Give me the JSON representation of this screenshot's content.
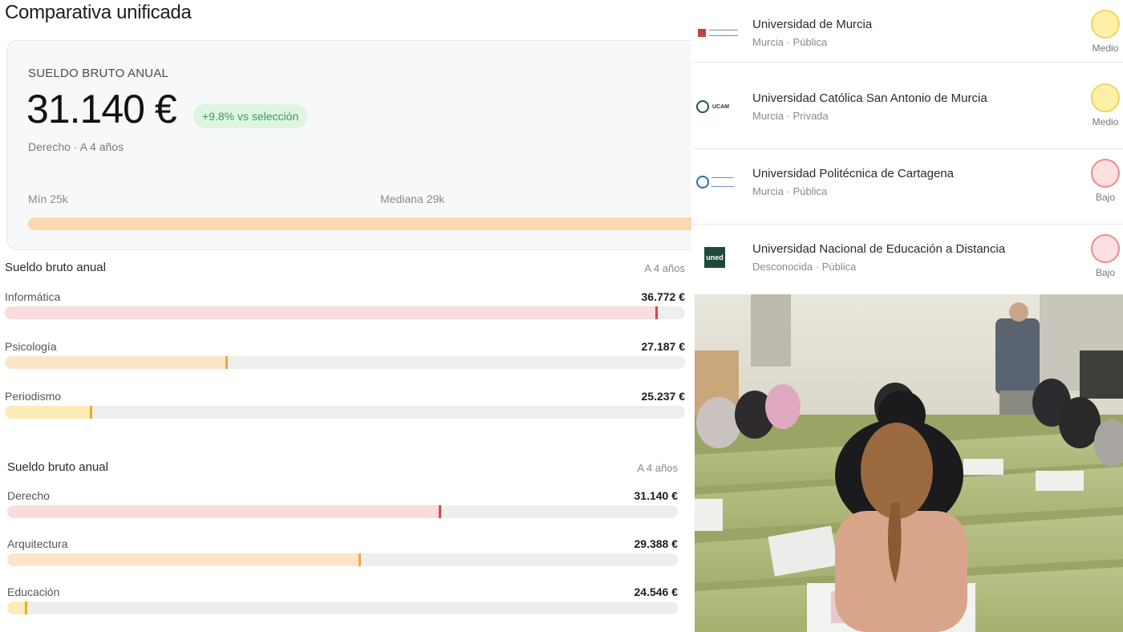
{
  "left": {
    "title": "Comparativa unificada",
    "card": {
      "label": "SUELDO BRUTO ANUAL",
      "value": "31.140 €",
      "badge": "+9.8% vs selección",
      "subtitle": "Derecho · A 4 años",
      "min_label": "Mín 25k",
      "median_label": "Mediana 29k"
    },
    "section1": {
      "heading": "Sueldo bruto anual",
      "period": "A 4 años",
      "rows": [
        {
          "label": "Informática",
          "value": "36.772 €",
          "fraction": 0.96,
          "fill_color": "#fadcdc",
          "mark_color": "#d9434b"
        },
        {
          "label": "Psicología",
          "value": "27.187 €",
          "fraction": 0.328,
          "fill_color": "#fde6c8",
          "mark_color": "#f0a53c"
        },
        {
          "label": "Periodismo",
          "value": "25.237 €",
          "fraction": 0.128,
          "fill_color": "#fdebb8",
          "mark_color": "#e0b020"
        }
      ]
    },
    "section2": {
      "heading": "Sueldo bruto anual",
      "period": "A 4 años",
      "rows": [
        {
          "label": "Derecho",
          "value": "31.140 €",
          "fraction": 0.647,
          "fill_color": "#fadcdc",
          "mark_color": "#d9434b"
        },
        {
          "label": "Arquitectura",
          "value": "29.388 €",
          "fraction": 0.527,
          "fill_color": "#fde6c8",
          "mark_color": "#f0a53c"
        },
        {
          "label": "Educación",
          "value": "24.546 €",
          "fraction": 0.03,
          "fill_color": "#fdebb8",
          "mark_color": "#e0b020"
        }
      ]
    }
  },
  "universities": [
    {
      "name": "Universidad de Murcia",
      "meta": "Murcia · Pública",
      "level": "Medio",
      "dot_color": "#fdf0a8",
      "dot_border": "#f0d460",
      "logo": "universidad-murcia-logo"
    },
    {
      "name": "Universidad Católica San Antonio de Murcia",
      "meta": "Murcia · Privada",
      "level": "Medio",
      "dot_color": "#fdf0a8",
      "dot_border": "#f0d460",
      "logo": "ucam-logo"
    },
    {
      "name": "Universidad Politécnica de Cartagena",
      "meta": "Murcia · Pública",
      "level": "Bajo",
      "dot_color": "#fde0e0",
      "dot_border": "#f08a8a",
      "logo": "upct-logo"
    },
    {
      "name": "Universidad Nacional de Educación a Distancia",
      "meta": "Desconocida · Pública",
      "level": "Bajo",
      "dot_color": "#fde0e0",
      "dot_border": "#f08a8a",
      "logo": "uned-logo"
    }
  ],
  "logos": {
    "uned_text": "uned",
    "ucam_text": "UCAM"
  }
}
